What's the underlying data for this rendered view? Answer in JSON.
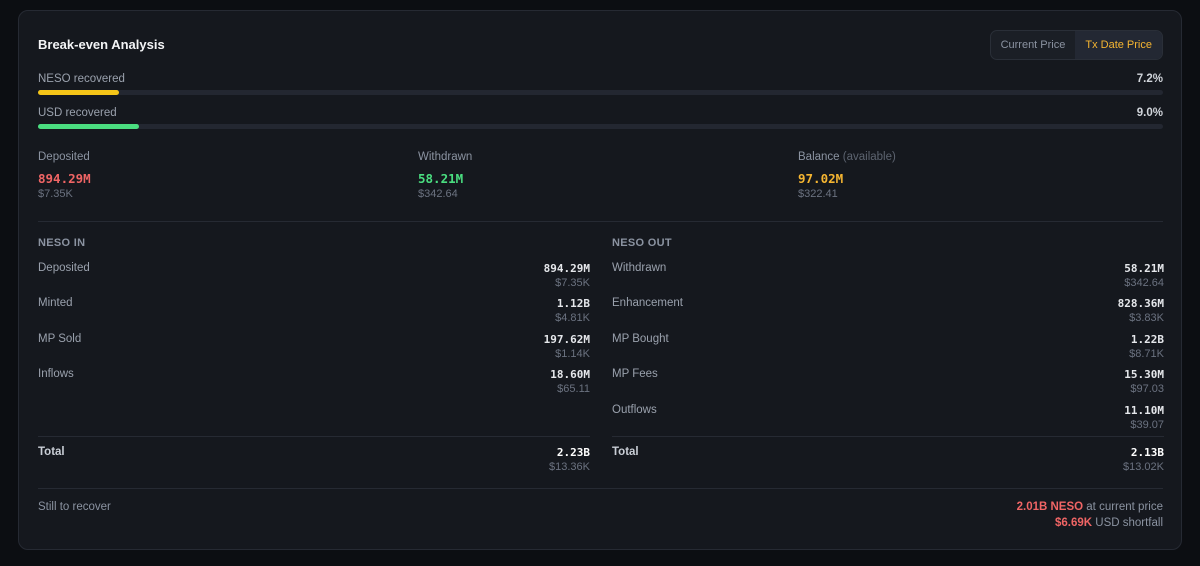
{
  "title": "Break-even Analysis",
  "price_toggle": {
    "options": [
      "Current Price",
      "Tx Date Price"
    ],
    "active": "Tx Date Price"
  },
  "progress": [
    {
      "label": "NESO recovered",
      "percent_text": "7.2%",
      "value": 7.2,
      "color": "#f5c518"
    },
    {
      "label": "USD recovered",
      "percent_text": "9.0%",
      "value": 9.0,
      "color": "#4ade80"
    }
  ],
  "summary": [
    {
      "label": "Deposited",
      "sub": "",
      "value": "894.29M",
      "usd": "$7.35K",
      "color": "#f06565"
    },
    {
      "label": "Withdrawn",
      "sub": "",
      "value": "58.21M",
      "usd": "$342.64",
      "color": "#4ade80"
    },
    {
      "label": "Balance",
      "sub": "(available)",
      "value": "97.02M",
      "usd": "$322.41",
      "color": "#f5b531"
    }
  ],
  "neso_in": {
    "heading": "NESO IN",
    "rows": [
      {
        "label": "Deposited",
        "value": "894.29M",
        "usd": "$7.35K"
      },
      {
        "label": "Minted",
        "value": "1.12B",
        "usd": "$4.81K"
      },
      {
        "label": "MP Sold",
        "value": "197.62M",
        "usd": "$1.14K"
      },
      {
        "label": "Inflows",
        "value": "18.60M",
        "usd": "$65.11"
      }
    ],
    "total": {
      "label": "Total",
      "value": "2.23B",
      "usd": "$13.36K"
    }
  },
  "neso_out": {
    "heading": "NESO OUT",
    "rows": [
      {
        "label": "Withdrawn",
        "value": "58.21M",
        "usd": "$342.64"
      },
      {
        "label": "Enhancement",
        "value": "828.36M",
        "usd": "$3.83K"
      },
      {
        "label": "MP Bought",
        "value": "1.22B",
        "usd": "$8.71K"
      },
      {
        "label": "MP Fees",
        "value": "15.30M",
        "usd": "$97.03"
      },
      {
        "label": "Outflows",
        "value": "11.10M",
        "usd": "$39.07"
      }
    ],
    "total": {
      "label": "Total",
      "value": "2.13B",
      "usd": "$13.02K"
    }
  },
  "still_to_recover": {
    "label": "Still to recover",
    "neso_value": "2.01B NESO",
    "neso_suffix": " at current price",
    "usd_value": "$6.69K",
    "usd_suffix": " USD shortfall"
  }
}
